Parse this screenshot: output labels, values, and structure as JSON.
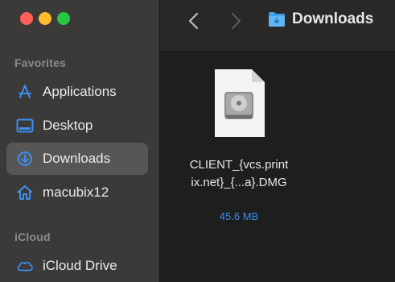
{
  "window": {
    "title": "Downloads"
  },
  "sidebar": {
    "sections": [
      {
        "label": "Favorites",
        "items": [
          {
            "label": "Applications",
            "icon": "applications-icon",
            "selected": false
          },
          {
            "label": "Desktop",
            "icon": "desktop-icon",
            "selected": false
          },
          {
            "label": "Downloads",
            "icon": "downloads-icon",
            "selected": true
          },
          {
            "label": "macubix12",
            "icon": "home-icon",
            "selected": false
          }
        ]
      },
      {
        "label": "iCloud",
        "items": [
          {
            "label": "iCloud Drive",
            "icon": "cloud-icon",
            "selected": false
          }
        ]
      }
    ]
  },
  "toolbar": {
    "location_title": "Downloads",
    "location_icon": "folder-icon"
  },
  "files": [
    {
      "name_line1": "CLIENT_{vcs.print",
      "name_line2": "ix.net}_{...a}.DMG",
      "size": "45.6 MB",
      "icon": "disk-image-icon"
    }
  ],
  "colors": {
    "accent": "#3d8ee5",
    "sidebar_bg": "#3b3a39",
    "selected_bg": "#575655",
    "content_bg": "#1e1e1e"
  }
}
